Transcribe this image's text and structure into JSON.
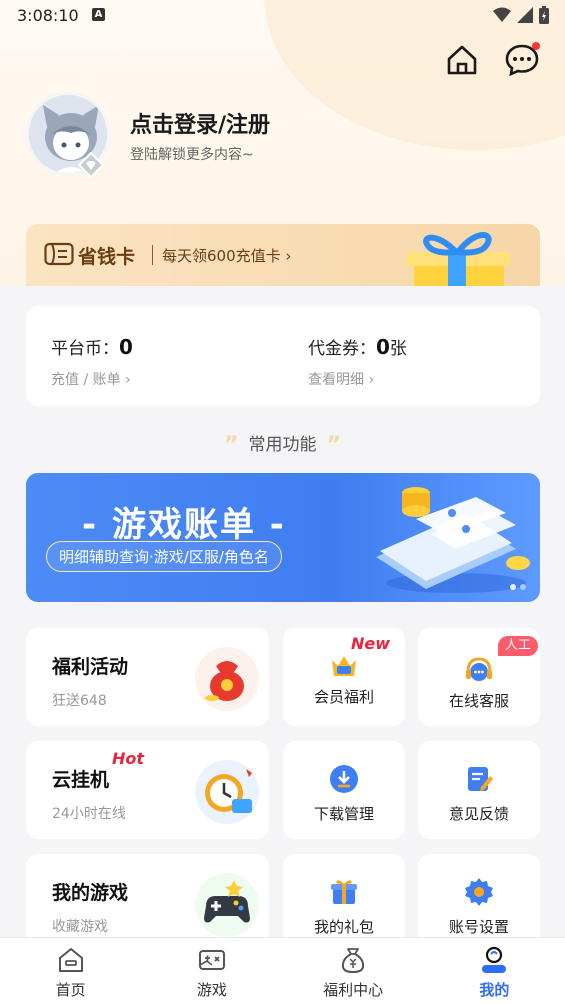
{
  "status_bar": {
    "time": "3:08:10",
    "indicator": "A"
  },
  "header": {
    "home_icon": "home-icon",
    "message_icon": "chat-bubble-icon"
  },
  "profile": {
    "title": "点击登录/注册",
    "subtitle": "登陆解锁更多内容~"
  },
  "saving_card": {
    "title": "省钱卡",
    "subtitle": "每天领600充值卡"
  },
  "wallet": {
    "coin_label": "平台币：",
    "coin_value": "0",
    "coin_link": "充值 / 账单",
    "voucher_label": "代金券：",
    "voucher_value": "0",
    "voucher_unit": "张",
    "voucher_link": "查看明细"
  },
  "section": {
    "title": "常用功能"
  },
  "banner": {
    "title": "- 游戏账单 -",
    "subtitle": "明细辅助查询·游戏/区服/角色名"
  },
  "features": {
    "welfare": {
      "title": "福利活动",
      "subtitle": "狂送648"
    },
    "cloud": {
      "title": "云挂机",
      "subtitle": "24小时在线",
      "tag": "Hot"
    },
    "my_games": {
      "title": "我的游戏",
      "subtitle": "收藏游戏"
    },
    "vip": {
      "label": "会员福利",
      "tag": "New"
    },
    "service": {
      "label": "在线客服",
      "tag": "人工"
    },
    "download": {
      "label": "下载管理"
    },
    "feedback": {
      "label": "意见反馈"
    },
    "gift": {
      "label": "我的礼包"
    },
    "settings": {
      "label": "账号设置"
    }
  },
  "bottom_nav": [
    {
      "label": "首页",
      "active": false
    },
    {
      "label": "游戏",
      "active": false
    },
    {
      "label": "福利中心",
      "active": false
    },
    {
      "label": "我的",
      "active": true
    }
  ],
  "colors": {
    "accent": "#2f6ff5",
    "hot": "#e8243f",
    "gold": "#6b3d13"
  }
}
